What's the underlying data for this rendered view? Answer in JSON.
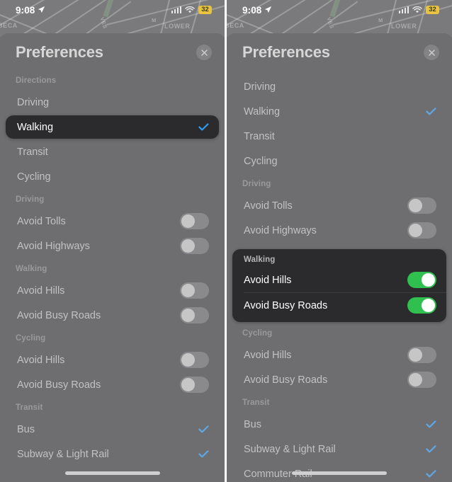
{
  "status_bar": {
    "time": "9:08",
    "location_arrow_icon": "location-arrow-icon",
    "cellular_icon": "cellular-bars-icon",
    "wifi_icon": "wifi-icon",
    "battery_percent": "32"
  },
  "map": {
    "labels": [
      "BECA",
      "LOWER",
      "M",
      "VES"
    ]
  },
  "sheet": {
    "title": "Preferences",
    "close_icon": "close-icon"
  },
  "left_panel": {
    "sections": [
      {
        "header": "Directions",
        "type": "choice",
        "rows": [
          {
            "label": "Driving",
            "checked": false,
            "highlighted": false
          },
          {
            "label": "Walking",
            "checked": true,
            "highlighted": true
          },
          {
            "label": "Transit",
            "checked": false,
            "highlighted": false
          },
          {
            "label": "Cycling",
            "checked": false,
            "highlighted": false
          }
        ]
      },
      {
        "header": "Driving",
        "type": "toggle",
        "rows": [
          {
            "label": "Avoid Tolls",
            "on": false
          },
          {
            "label": "Avoid Highways",
            "on": false
          }
        ]
      },
      {
        "header": "Walking",
        "type": "toggle",
        "rows": [
          {
            "label": "Avoid Hills",
            "on": false
          },
          {
            "label": "Avoid Busy Roads",
            "on": false
          }
        ]
      },
      {
        "header": "Cycling",
        "type": "toggle",
        "rows": [
          {
            "label": "Avoid Hills",
            "on": false
          },
          {
            "label": "Avoid Busy Roads",
            "on": false
          }
        ]
      },
      {
        "header": "Transit",
        "type": "choice",
        "rows": [
          {
            "label": "Bus",
            "checked": true
          },
          {
            "label": "Subway & Light Rail",
            "checked": true
          }
        ]
      }
    ]
  },
  "right_panel": {
    "sections": [
      {
        "header": "",
        "type": "choice",
        "rows": [
          {
            "label": "Driving",
            "checked": false
          },
          {
            "label": "Walking",
            "checked": true
          },
          {
            "label": "Transit",
            "checked": false
          },
          {
            "label": "Cycling",
            "checked": false
          }
        ]
      },
      {
        "header": "Driving",
        "type": "toggle",
        "rows": [
          {
            "label": "Avoid Tolls",
            "on": false
          },
          {
            "label": "Avoid Highways",
            "on": false
          }
        ]
      },
      {
        "header": "Walking",
        "type": "toggle",
        "highlighted": true,
        "rows": [
          {
            "label": "Avoid Hills",
            "on": true
          },
          {
            "label": "Avoid Busy Roads",
            "on": true
          }
        ]
      },
      {
        "header": "Cycling",
        "type": "toggle",
        "rows": [
          {
            "label": "Avoid Hills",
            "on": false
          },
          {
            "label": "Avoid Busy Roads",
            "on": false
          }
        ]
      },
      {
        "header": "Transit",
        "type": "choice",
        "rows": [
          {
            "label": "Bus",
            "checked": true
          },
          {
            "label": "Subway & Light Rail",
            "checked": true
          },
          {
            "label": "Commuter Rail",
            "checked": true
          }
        ]
      }
    ]
  },
  "colors": {
    "accent_blue": "#2f9bf0",
    "toggle_on_green": "#2fc04f",
    "sheet_bg": "#6e6e70",
    "highlight_bg": "#2b2b2d",
    "battery_yellow": "#e8c341"
  }
}
